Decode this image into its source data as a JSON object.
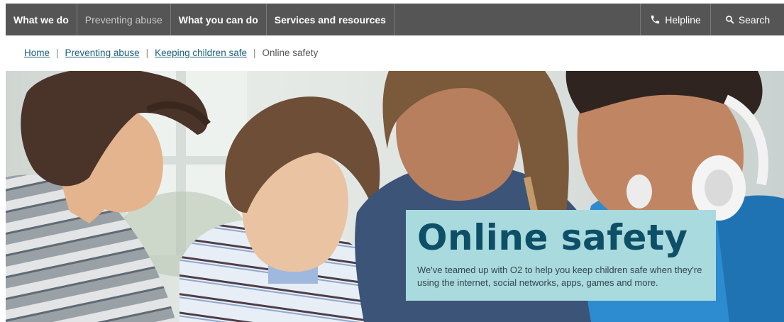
{
  "nav": {
    "items": [
      {
        "label": "What we do"
      },
      {
        "label": "Preventing abuse"
      },
      {
        "label": "What you can do"
      },
      {
        "label": "Services and resources"
      }
    ],
    "helpline": {
      "label": "Helpline",
      "icon": "phone-icon"
    },
    "search": {
      "label": "Search",
      "icon": "search-icon"
    }
  },
  "breadcrumb": {
    "links": [
      "Home",
      "Preventing abuse",
      "Keeping children safe"
    ],
    "current": "Online safety"
  },
  "hero": {
    "title": "Online safety",
    "text": "We've teamed up with O2 to help you keep children safe when they're using the internet, social networks, apps, games and more."
  },
  "colors": {
    "nav_bg": "#555555",
    "link": "#1d5f7a",
    "panel_bg": "#a9dadd",
    "title": "#0e4f68"
  }
}
